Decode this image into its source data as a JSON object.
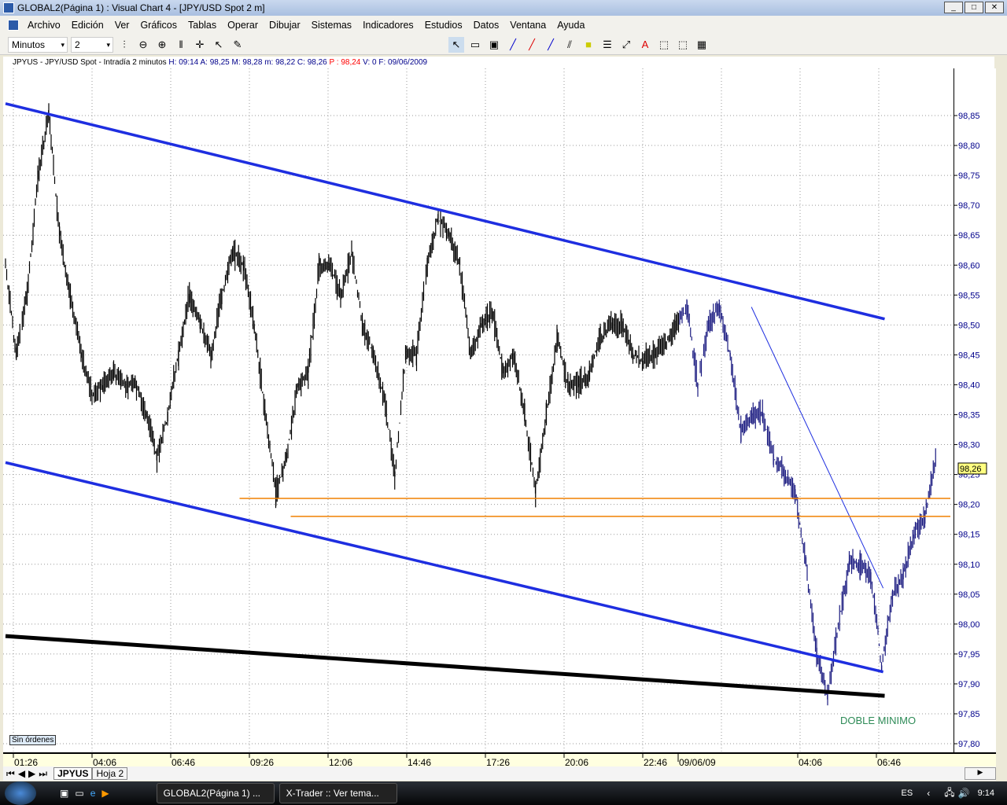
{
  "window": {
    "title": "GLOBAL2(Página 1) : Visual Chart 4 - [JPY/USD Spot 2 m]"
  },
  "menu": [
    "Archivo",
    "Edición",
    "Ver",
    "Gráficos",
    "Tablas",
    "Operar",
    "Dibujar",
    "Sistemas",
    "Indicadores",
    "Estudios",
    "Datos",
    "Ventana",
    "Ayuda"
  ],
  "toolbar": {
    "period_unit": "Minutos",
    "period_value": "2"
  },
  "info": {
    "symbol": "JPYUS - JPY/USD Spot - Intradía 2 minutos",
    "h": "H: 09:14",
    "a": "A: 98,25",
    "m": "M: 98,28",
    "mlow": "m: 98,22",
    "c": "C: 98,26",
    "p": "P : 98,24",
    "v": "V: 0",
    "f": "F: 09/06/2009"
  },
  "orders_label": "Sin órdenes",
  "annotation": "DOBLE MINIMO",
  "last_price": "98,26",
  "sheets": [
    "JPYUS",
    "Hoja 2"
  ],
  "taskbar": {
    "tasks": [
      "GLOBAL2(Página 1) ...",
      "X-Trader :: Ver tema..."
    ],
    "lang": "ES",
    "clock": "9:14"
  },
  "colors": {
    "channel": "#1e2ee0",
    "support": "#000000",
    "horizontal": "#f08000",
    "price_day1": "#000000",
    "price_day2": "#1a1a80",
    "annotation": "#2e8b57"
  },
  "chart_data": {
    "type": "line",
    "ylim": [
      97.78,
      98.88
    ],
    "yticks": [
      "98,85",
      "98,80",
      "98,75",
      "98,70",
      "98,65",
      "98,60",
      "98,55",
      "98,50",
      "98,45",
      "98,40",
      "98,35",
      "98,30",
      "98,25",
      "98,20",
      "98,15",
      "98,10",
      "98,05",
      "98,00",
      "97,95",
      "97,90",
      "97,85",
      "97,80"
    ],
    "xticks": [
      "01:26",
      "04:06",
      "06:46",
      "09:26",
      "12:06",
      "14:46",
      "17:26",
      "20:06",
      "22:46",
      "09/06/09",
      "04:06",
      "06:46"
    ],
    "series_start": "08/06/09 01:10",
    "interval_minutes": 22,
    "values": [
      98.6,
      98.45,
      98.55,
      98.75,
      98.85,
      98.65,
      98.55,
      98.45,
      98.38,
      98.4,
      98.42,
      98.4,
      98.4,
      98.35,
      98.28,
      98.35,
      98.45,
      98.55,
      98.5,
      98.45,
      98.55,
      98.62,
      98.6,
      98.5,
      98.35,
      98.22,
      98.28,
      98.4,
      98.42,
      98.6,
      98.6,
      98.55,
      98.62,
      98.5,
      98.45,
      98.38,
      98.25,
      98.45,
      98.45,
      98.6,
      98.68,
      98.65,
      98.6,
      98.45,
      98.5,
      98.52,
      98.42,
      98.45,
      98.35,
      98.22,
      98.35,
      98.48,
      98.4,
      98.4,
      98.42,
      98.48,
      98.5,
      98.5,
      98.45,
      98.44,
      98.45,
      98.47,
      98.5,
      98.53,
      98.4,
      98.5,
      98.53,
      98.45,
      98.32,
      98.35,
      98.35,
      98.28,
      98.25,
      98.22,
      98.1,
      97.95,
      97.88,
      98.0,
      98.1,
      98.1,
      98.08,
      97.93,
      98.05,
      98.08,
      98.15,
      98.18,
      98.28
    ],
    "lines": [
      {
        "kind": "upper-channel",
        "from": [
          "08/06/09 01:10",
          98.87
        ],
        "to": [
          "09/06/09 06:58",
          98.51
        ]
      },
      {
        "kind": "lower-channel",
        "from": [
          "08/06/09 01:10",
          98.27
        ],
        "to": [
          "09/06/09 06:55",
          97.92
        ]
      },
      {
        "kind": "support",
        "from": [
          "08/06/09 01:10",
          97.98
        ],
        "to": [
          "09/06/09 06:58",
          97.88
        ]
      },
      {
        "kind": "thin-trend",
        "from": [
          "09/06/09 02:27",
          98.53
        ],
        "to": [
          "09/06/09 06:55",
          98.06
        ]
      },
      {
        "kind": "horizontal",
        "price": 98.21,
        "from": "08/06/09 09:06"
      },
      {
        "kind": "horizontal",
        "price": 98.18,
        "from": "08/06/09 10:50"
      }
    ]
  }
}
